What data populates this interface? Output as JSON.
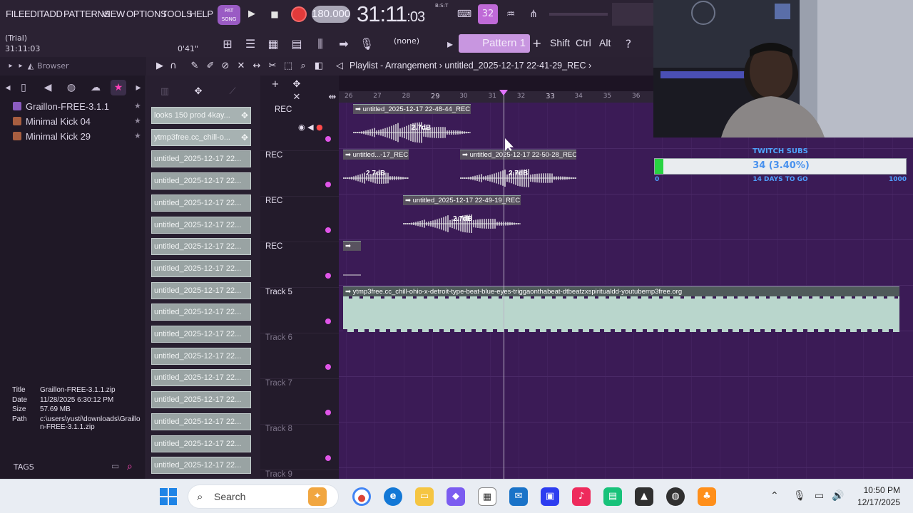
{
  "menu": [
    "FILE",
    "EDIT",
    "ADD",
    "PATTERNS",
    "VIEW",
    "OPTIONS",
    "TOOLS",
    "HELP"
  ],
  "transport": {
    "mode_top": "PAT",
    "mode_bottom": "SONG",
    "tempo": "180.000",
    "time_main": "31:11",
    "time_sub": "03",
    "time_mode": "B:S:T",
    "cpu_label": "32"
  },
  "toolbar2": {
    "trial_label": "(Trial)",
    "trial_time": "31:11:03",
    "song_position": "0'41\"",
    "pattern_none": "(none)",
    "pattern_name": "Pattern 1",
    "pattern_add": "+",
    "keys": [
      "Shift",
      "Ctrl",
      "Alt"
    ]
  },
  "browser": {
    "title": "Browser",
    "items": [
      {
        "label": "Graillon-FREE-3.1.1"
      },
      {
        "label": "Minimal Kick 04"
      },
      {
        "label": "Minimal Kick 29"
      }
    ],
    "info": [
      {
        "key": "Title",
        "value": "Graillon-FREE-3.1.1.zip"
      },
      {
        "key": "Date",
        "value": "11/28/2025 6:30:12 PM"
      },
      {
        "key": "Size",
        "value": "57.69 MB"
      },
      {
        "key": "Path",
        "value": "c:\\users\\yusti\\downloads\\Graillon-FREE-3.1.1.zip"
      }
    ],
    "tags_label": "TAGS"
  },
  "clips": [
    "looks 150 prod 4kay...",
    "ytmp3free.cc_chill-o...",
    "untitled_2025-12-17 22...",
    "untitled_2025-12-17 22...",
    "untitled_2025-12-17 22...",
    "untitled_2025-12-17 22...",
    "untitled_2025-12-17 22...",
    "untitled_2025-12-17 22...",
    "untitled_2025-12-17 22...",
    "untitled_2025-12-17 22...",
    "untitled_2025-12-17 22...",
    "untitled_2025-12-17 22...",
    "untitled_2025-12-17 22...",
    "untitled_2025-12-17 22...",
    "untitled_2025-12-17 22...",
    "untitled_2025-12-17 22...",
    "untitled_2025-12-17 22..."
  ],
  "playlist": {
    "title_prefix": "Playlist - Arrangement",
    "separator": "›",
    "project_name": "untitled_2025-12-17 22-41-29_REC",
    "bars": [
      "26",
      "27",
      "28",
      "29",
      "30",
      "31",
      "32",
      "33",
      "34",
      "35",
      "36"
    ],
    "tracks": [
      "REC",
      "REC",
      "REC",
      "REC",
      "Track 5",
      "Track 6",
      "Track 7",
      "Track 8",
      "Track 9"
    ],
    "audio_clips": [
      {
        "title": "untitled_2025-12-17 22-48-44_REC",
        "gain": "2.7dB"
      },
      {
        "title": "untitled...-17_REC",
        "gain": "2.7dB"
      },
      {
        "title": "untitled_2025-12-17 22-50-28_REC",
        "gain": "2.7dB"
      },
      {
        "title": "untitled_2025-12-17 22-49-19_REC",
        "gain": "2.7dB"
      },
      {
        "title": "",
        "gain": ""
      },
      {
        "title": "ytmp3free.cc_chill-ohio-x-detroit-type-beat-blue-eyes-triggaonthabeat-dtbeatzxspiritualdd-youtubemp3free.org",
        "gain": ""
      }
    ]
  },
  "subs": {
    "label": "TWITCH SUBS",
    "current": 34,
    "goal": 1000,
    "progress_fraction": 0.034,
    "display": "34 (3.40%)",
    "min_label": "0",
    "remaining_label": "14 DAYS TO GO",
    "max_label": "1000"
  },
  "taskbar": {
    "search_text": "Search",
    "time": "10:50 PM",
    "date": "12/17/2025"
  },
  "colors": {
    "accent": "#c896e0",
    "grid": "#3b1b56",
    "clip": "#99a3a3",
    "record": "#e33a3a",
    "subs_fill": "#28d342"
  }
}
